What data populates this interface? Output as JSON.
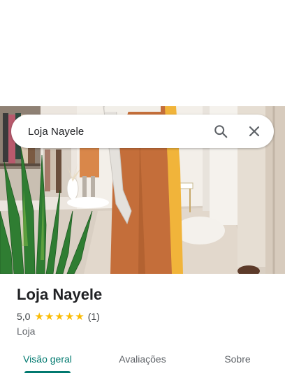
{
  "search": {
    "query": "Loja Nayele"
  },
  "place": {
    "name": "Loja Nayele",
    "rating": "5,0",
    "stars": 5,
    "review_count": "(1)",
    "category": "Loja"
  },
  "tabs": [
    {
      "label": "Visão geral",
      "active": true
    },
    {
      "label": "Avaliações",
      "active": false
    },
    {
      "label": "Sobre",
      "active": false
    }
  ],
  "colors": {
    "accent": "#01796f",
    "star": "#fbbc04"
  },
  "icons": {
    "search": "search-icon",
    "close": "close-icon",
    "star": "star-icon"
  }
}
